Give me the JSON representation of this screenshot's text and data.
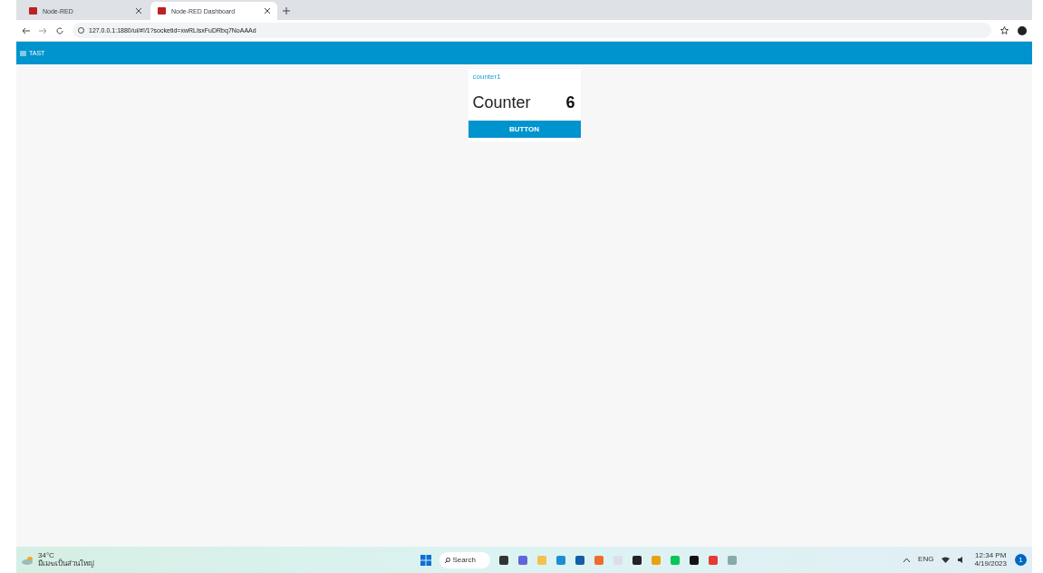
{
  "browser": {
    "tabs": [
      {
        "title": "Node-RED",
        "selected": false
      },
      {
        "title": "Node-RED Dashboard",
        "selected": true
      }
    ],
    "address": "127.0.0.1:1880/ui/#!/1?socketid=xwRLIsxFuDRbq7NoAAAd"
  },
  "dashboard": {
    "title": "TAST",
    "card": {
      "title": "counter1",
      "label": "Counter",
      "value": "6",
      "button": "BUTTON"
    }
  },
  "taskbar": {
    "weather": {
      "temperature": "34°C",
      "condition": "มีเมฆเป็นส่วนใหญ่"
    },
    "search": "Search",
    "language": "ENG",
    "time": "12:34 PM",
    "date": "4/19/2023",
    "notifications": "1"
  }
}
